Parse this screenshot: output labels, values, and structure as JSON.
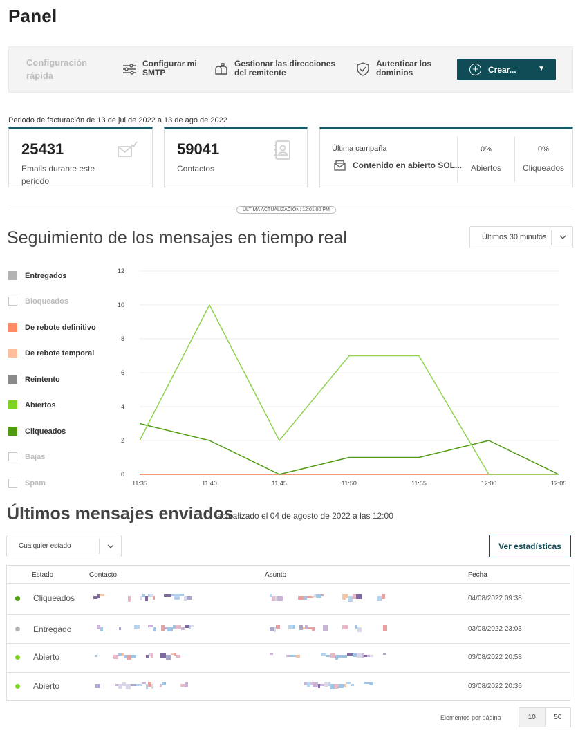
{
  "page": {
    "title": "Panel"
  },
  "quick_setup": {
    "title": "Configuración rápida",
    "items": [
      {
        "label": "Configurar mi SMTP",
        "icon": "sliders-icon"
      },
      {
        "label": "Gestionar las direcciones del remitente",
        "icon": "mailbox-icon"
      },
      {
        "label": "Autenticar los dominios",
        "icon": "shield-check-icon"
      }
    ],
    "create_label": "Crear..."
  },
  "billing": {
    "text": "Periodo de facturación de 13 de jul de 2022 a 13 de ago de 2022"
  },
  "cards": {
    "emails": {
      "value": "25431",
      "label": "Emails durante este periodo",
      "icon": "email-sent-icon"
    },
    "contacts": {
      "value": "59041",
      "label": "Contactos",
      "icon": "address-book-icon"
    },
    "campaign": {
      "label": "Última campaña",
      "name": "Contenido en abierto SOL...",
      "opened_value": "0%",
      "opened_label": "Abiertos",
      "clicked_value": "0%",
      "clicked_label": "Cliqueados"
    }
  },
  "last_update": "ÚLTIMA ACTUALIZACIÓN: 12:01:00 PM",
  "tracking": {
    "title": "Seguimiento de los mensajes en tiempo real",
    "range": "Últimos 30 minutos",
    "legend": [
      {
        "label": "Entregados",
        "color": "#b3b3b3",
        "active": true
      },
      {
        "label": "Bloqueados",
        "color": "#ffffff",
        "active": false
      },
      {
        "label": "De rebote definitivo",
        "color": "#ff8a65",
        "active": true
      },
      {
        "label": "De rebote temporal",
        "color": "#ffbf9c",
        "active": true
      },
      {
        "label": "Reintento",
        "color": "#8a8a8a",
        "active": true
      },
      {
        "label": "Abiertos",
        "color": "#7ed321",
        "active": true
      },
      {
        "label": "Cliqueados",
        "color": "#4f9a10",
        "active": true
      },
      {
        "label": "Bajas",
        "color": "#ffffff",
        "active": false
      },
      {
        "label": "Spam",
        "color": "#ffffff",
        "active": false
      }
    ]
  },
  "chart_data": {
    "type": "line",
    "x": [
      "11:35",
      "11:40",
      "11:45",
      "11:50",
      "11:55",
      "12:00",
      "12:05"
    ],
    "ylim": [
      0,
      12
    ],
    "yticks": [
      0,
      2,
      4,
      6,
      8,
      10,
      12
    ],
    "grid": true,
    "series": [
      {
        "name": "Abiertos",
        "color": "#8fd14f",
        "values": [
          2,
          10,
          2,
          7,
          7,
          0,
          0
        ]
      },
      {
        "name": "Cliqueados",
        "color": "#4f9a10",
        "values": [
          3,
          2,
          0,
          1,
          1,
          2,
          0
        ]
      },
      {
        "name": "De rebote definitivo",
        "color": "#ff8a65",
        "values": [
          0,
          0,
          0,
          0,
          0,
          0,
          0
        ]
      },
      {
        "name": "Reintento",
        "color": "#8a8a8a",
        "values": [
          0,
          0,
          0,
          0,
          0,
          0,
          0
        ]
      }
    ]
  },
  "sent": {
    "title": "Últimos mensajes enviados",
    "subtitle": "actualizado el 04 de agosto de 2022 a las 12:00",
    "filter": "Cualquier estado",
    "stats_button": "Ver estadísticas",
    "columns": [
      "Estado",
      "Contacto",
      "Asunto",
      "Fecha"
    ],
    "rows": [
      {
        "state": "Cliqueados",
        "dot": "#4f9a10",
        "date": "04/08/2022 09:38"
      },
      {
        "state": "Entregado",
        "dot": "#b3b3b3",
        "date": "03/08/2022 23:03"
      },
      {
        "state": "Abierto",
        "dot": "#7ed321",
        "date": "03/08/2022 20:58"
      },
      {
        "state": "Abierto",
        "dot": "#7ed321",
        "date": "03/08/2022 20:36"
      }
    ]
  },
  "pagination": {
    "label": "Elementos por página",
    "options": [
      "10",
      "50"
    ]
  }
}
